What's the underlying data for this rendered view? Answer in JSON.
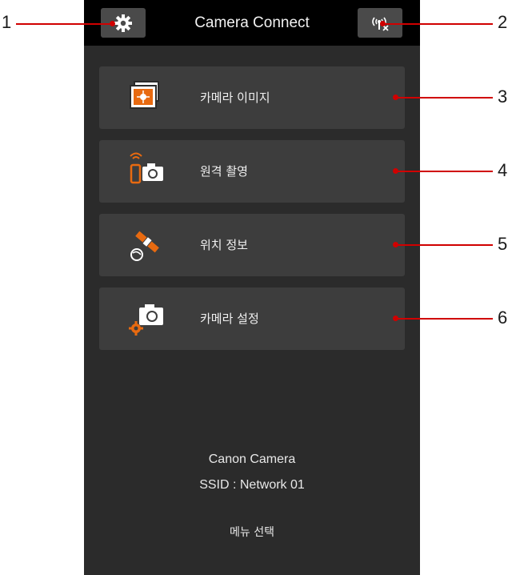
{
  "app": {
    "title": "Camera Connect"
  },
  "toolbar": {
    "settings_icon": "gear-icon",
    "wifi_icon": "wireless-disconnect-icon"
  },
  "menu": [
    {
      "label": "카메라 이미지",
      "icon": "camera-images-icon"
    },
    {
      "label": "원격 촬영",
      "icon": "remote-shooting-icon"
    },
    {
      "label": "위치 정보",
      "icon": "location-info-icon"
    },
    {
      "label": "카메라 설정",
      "icon": "camera-settings-icon"
    }
  ],
  "info": {
    "camera_name": "Canon Camera",
    "ssid": "SSID : Network 01"
  },
  "footer": {
    "label": "메뉴 선택"
  },
  "callouts": [
    "1",
    "2",
    "3",
    "4",
    "5",
    "6"
  ],
  "colors": {
    "accent": "#e86a10",
    "callout": "#d00000",
    "screen_bg": "#2b2b2b",
    "topbar_bg": "#000000"
  }
}
